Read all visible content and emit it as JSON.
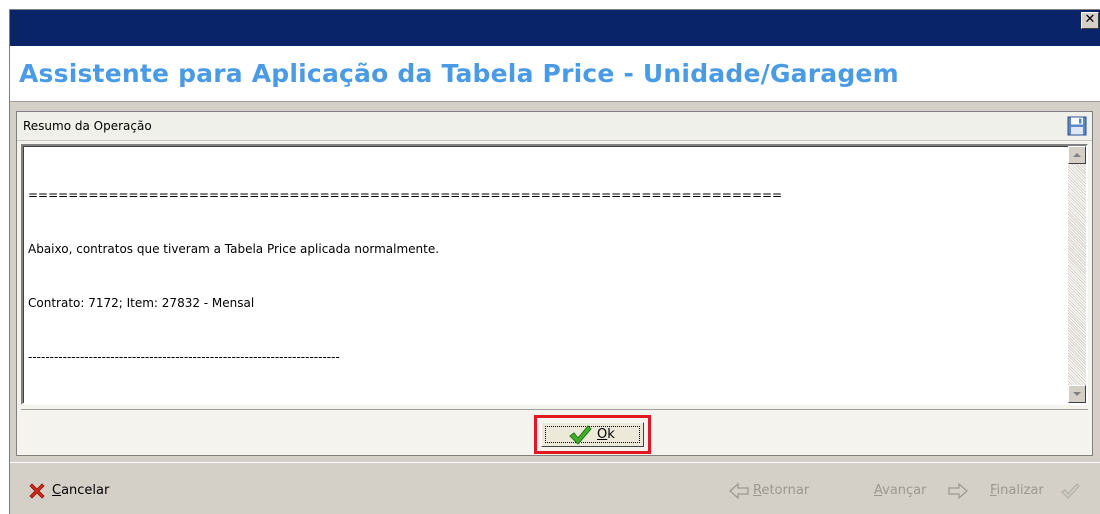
{
  "window": {
    "title": "",
    "close_glyph": "✕"
  },
  "wizard": {
    "heading": "Assistente para Aplicação da Tabela Price - Unidade/Garagem"
  },
  "summary": {
    "group_title": "Resumo da Operação",
    "save_icon": "floppy-disk-icon",
    "lines": [
      "===========================================================================",
      "Abaixo, contratos que tiveram a Tabela Price aplicada normalmente.",
      "Contrato: 7172; Item: 27832 - Mensal",
      "------------------------------------------------------------------------"
    ]
  },
  "dialog": {
    "ok_mnemonic": "O",
    "ok_rest": "k",
    "ok_icon": "checkmark-icon",
    "highlight_color": "#e01820"
  },
  "footer": {
    "cancel_mnemonic": "C",
    "cancel_rest": "ancelar",
    "cancel_icon": "red-x-icon",
    "back_label": "Retornar",
    "next_label": "Avançar",
    "finish_label": "Finalizar"
  },
  "colors": {
    "titlebar": "#0a246a",
    "heading": "#4a9be6",
    "face": "#d4d0c8",
    "disabled_text": "#9a9890"
  }
}
